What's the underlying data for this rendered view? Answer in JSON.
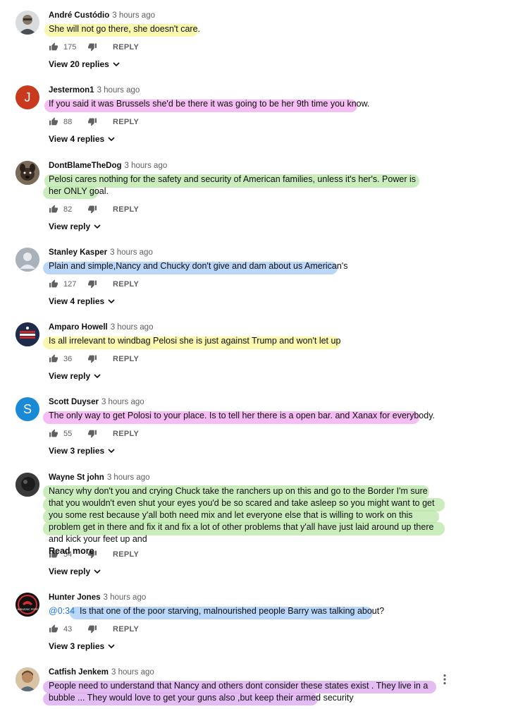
{
  "comments": [
    {
      "author": "André Custódio",
      "time": "3 hours ago",
      "text": "She will not go there, she doesn't care.",
      "likes": "175",
      "reply_label": "REPLY",
      "replies_label": "View 20 replies",
      "avatar": {
        "letter": "",
        "color": "#9aa3a8",
        "icon": "person-photo-avatar"
      },
      "highlight_color": "#f7f58c"
    },
    {
      "author": "Jestermon1",
      "time": "3 hours ago",
      "text": "If you said it was Brussels she'd be there it was going to be her 9th time you know.",
      "likes": "88",
      "reply_label": "REPLY",
      "replies_label": "View 4 replies",
      "avatar": {
        "letter": "J",
        "color": "#c8391d",
        "icon": ""
      },
      "highlight_color": "#f2a0f0"
    },
    {
      "author": "DontBlameTheDog",
      "time": "3 hours ago",
      "text": "Pelosi cares nothing for the safety and security of American families, unless it's her's.  Power is her ONLY goal.",
      "likes": "82",
      "reply_label": "REPLY",
      "replies_label": "View reply",
      "avatar": {
        "letter": "",
        "color": "#6b5a4a",
        "icon": "dog-photo-avatar"
      },
      "highlight_color": "#b5e5a2"
    },
    {
      "author": "Stanley Kasper",
      "time": "3 hours ago",
      "text": "Plain and simple,Nancy and Chucky don't give and dam about us American's",
      "likes": "127",
      "reply_label": "REPLY",
      "replies_label": "View 4 replies",
      "avatar": {
        "letter": "",
        "color": "#a9b1bb",
        "icon": "default-person-avatar"
      },
      "highlight_color": "#9cc6f7"
    },
    {
      "author": "Amparo Howell",
      "time": "3 hours ago",
      "text": "Is all irrelevant to windbag Pelosi she is just against Trump and won't let up",
      "likes": "36",
      "reply_label": "REPLY",
      "replies_label": "View reply",
      "avatar": {
        "letter": "",
        "color": "#1e2b4a",
        "icon": "flag-photo-avatar"
      },
      "highlight_color": "#f7f58c"
    },
    {
      "author": "Scott Duyser",
      "time": "3 hours ago",
      "text": "The only way to get Polosi to your place. Is to tell her there is a open bar. and Xanax for everybody.",
      "likes": "55",
      "reply_label": "REPLY",
      "replies_label": "View 3 replies",
      "avatar": {
        "letter": "S",
        "color": "#1a8ad6",
        "icon": ""
      },
      "highlight_color": "#f2a0f0"
    },
    {
      "author": "Wayne St john",
      "time": "3 hours ago",
      "text": "Nancy why don't you and crying Chuck take the ranchers up on this and go to the Border I'm sure that you wouldn't even shut your eyes you'd be so scared and take asleep so you might want to get you some rest because y'all both need mix and let everyone else that is willing to work on this problem get in there and fix it and fix a lot of other problems that y'all have just laid around up there and kick your feet up and",
      "read_more": "Read more",
      "likes": "54",
      "reply_label": "REPLY",
      "replies_label": "View reply",
      "avatar": {
        "letter": "",
        "color": "#2b2b2b",
        "icon": "dark-photo-avatar"
      },
      "highlight_color": "#b5e5a2"
    },
    {
      "author": "Hunter Jones",
      "time": "3 hours ago",
      "timestamp_link": "@0:34",
      "text": "Is that one of the poor starving, malnourished people Barry was talking about?",
      "likes": "43",
      "reply_label": "REPLY",
      "replies_label": "View 3 replies",
      "avatar": {
        "letter": "",
        "color": "#111111",
        "icon": "jurassic-logo-avatar"
      },
      "avatar_text": "JURASSIC PEPE",
      "highlight_color": "#9cc6f7"
    },
    {
      "author": "Catfish Jenkem",
      "time": "3 hours ago",
      "text": "People need to understand that Nancy and others dont consider these states exist . They live in a bubble ... They would love to get your guns also ,but keep their armed security",
      "avatar": {
        "letter": "",
        "color": "#c9a27e",
        "icon": "person-photo-avatar"
      },
      "highlight_color": "#d7a0ee"
    }
  ]
}
